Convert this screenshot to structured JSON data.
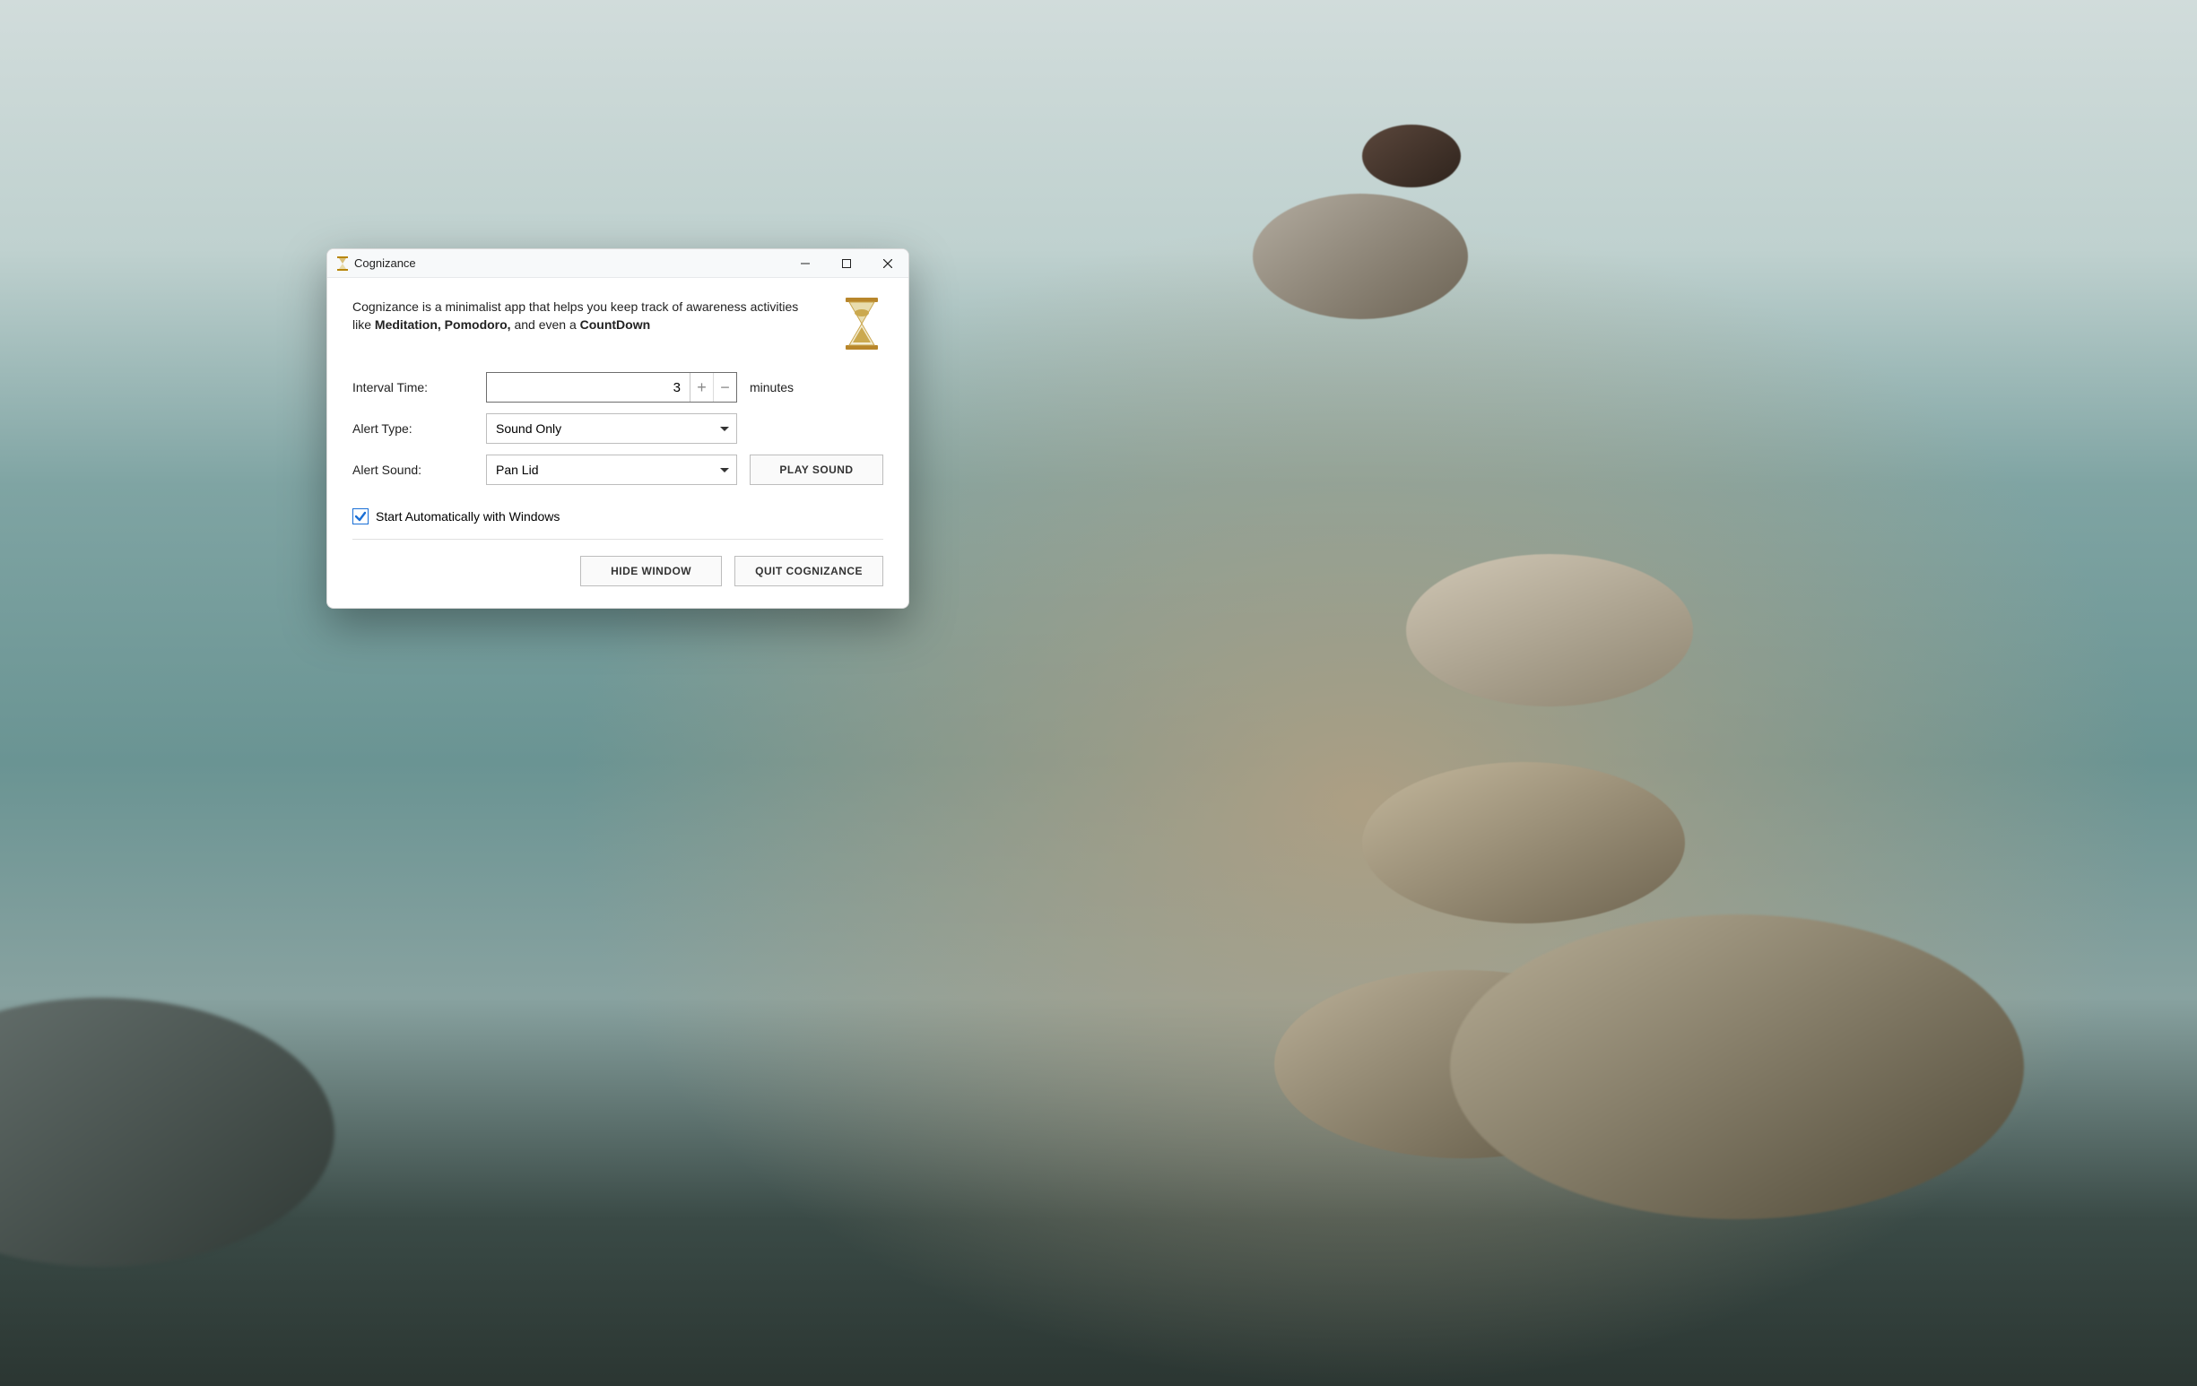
{
  "window": {
    "title": "Cognizance"
  },
  "blurb": {
    "lead": "Cognizance is a minimalist app that helps you keep track of awareness activities like ",
    "bold1": "Meditation, Pomodoro,",
    "mid": " and even a ",
    "bold2": "CountDown"
  },
  "form": {
    "interval_label": "Interval Time:",
    "interval_value": "3",
    "interval_units": "minutes",
    "alert_type_label": "Alert Type:",
    "alert_type_value": "Sound Only",
    "alert_sound_label": "Alert Sound:",
    "alert_sound_value": "Pan Lid",
    "play_sound_label": "Play Sound"
  },
  "autostart": {
    "checked": true,
    "label": "Start Automatically with Windows"
  },
  "footer": {
    "hide_label": "Hide Window",
    "quit_label": "Quit Cognizance"
  }
}
